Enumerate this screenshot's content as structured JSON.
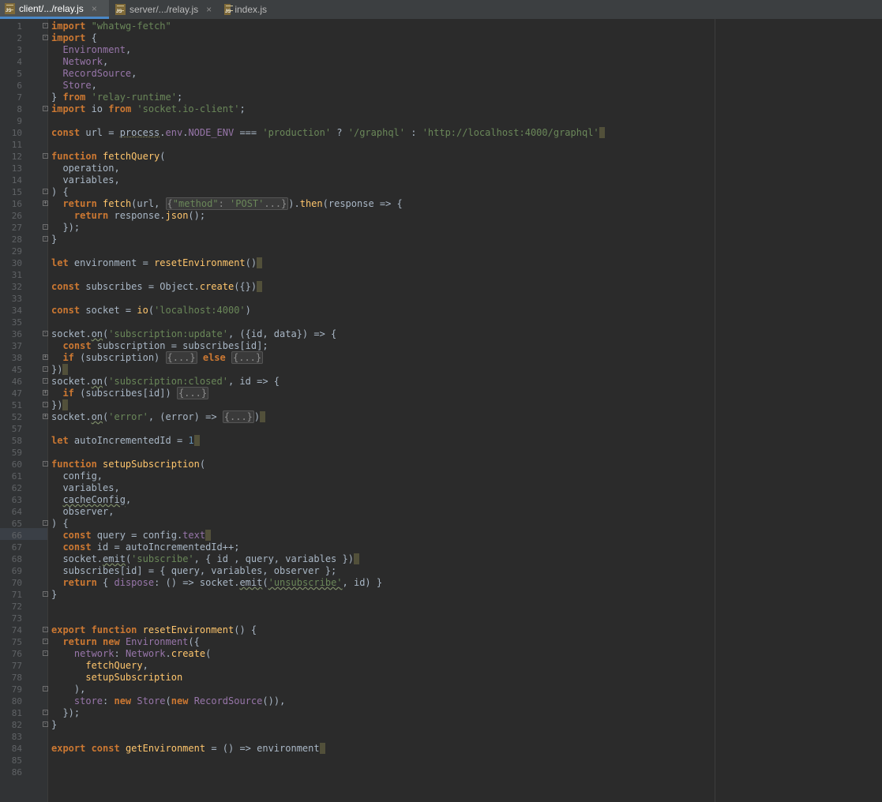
{
  "tabs": [
    {
      "label": "client/.../relay.js",
      "icon": "js-file-icon",
      "icon_text": "JS",
      "close": "×",
      "active": true
    },
    {
      "label": "server/.../relay.js",
      "icon": "js-file-icon",
      "icon_text": "JS",
      "close": "×",
      "active": false
    },
    {
      "label": "index.js",
      "icon": "js-file-icon",
      "icon_text": "JS",
      "close": "",
      "active": false
    }
  ],
  "editor": {
    "current_line": 66,
    "lines": [
      {
        "n": "1",
        "fold": "-",
        "html": "<span class='kw'>import</span> <span class='str'>\"whatwg-fetch\"</span>"
      },
      {
        "n": "2",
        "fold": "-",
        "html": "<span class='kw'>import</span> {"
      },
      {
        "n": "3",
        "html": "  <span class='pur'>Environment</span>,"
      },
      {
        "n": "4",
        "html": "  <span class='pur'>Network</span>,"
      },
      {
        "n": "5",
        "html": "  <span class='pur'>RecordSource</span>,"
      },
      {
        "n": "6",
        "html": "  <span class='pur'>Store</span>,"
      },
      {
        "n": "7",
        "html": "} <span class='kw'>from</span> <span class='str'>'relay-runtime'</span>;"
      },
      {
        "n": "8",
        "fold": "-",
        "html": "<span class='kw'>import</span> io <span class='kw'>from</span> <span class='str'>'socket.io-client'</span>;"
      },
      {
        "n": "9",
        "html": ""
      },
      {
        "n": "10",
        "html": "<span class='kw'>const</span> url = <span class='warn'>process</span>.<span class='fld'>env</span>.<span class='fld'>NODE_ENV</span> === <span class='str'>'production'</span> ? <span class='str'>'/graphql'</span> : <span class='str'>'http://localhost:4000/graphql'</span><span class='caret'></span>"
      },
      {
        "n": "11",
        "html": ""
      },
      {
        "n": "12",
        "fold": "-",
        "html": "<span class='kw'>function</span> <span class='fn'>fetchQuery</span>("
      },
      {
        "n": "13",
        "html": "  operation,"
      },
      {
        "n": "14",
        "html": "  variables,"
      },
      {
        "n": "15",
        "fold": "-",
        "html": ") {"
      },
      {
        "n": "16",
        "fold": "+",
        "html": "  <span class='kw'>return</span> <span class='fn'>fetch</span>(url, <span class='fg'>{<span class='str'>\"method\"</span>: <span class='str'>'POST'</span>...}</span>).<span class='fn'>then</span>(response => {"
      },
      {
        "n": "26",
        "html": "    <span class='kw'>return</span> response.<span class='fn'>json</span>();"
      },
      {
        "n": "27",
        "fold": "-",
        "html": "  });"
      },
      {
        "n": "28",
        "fold": "-",
        "html": "}"
      },
      {
        "n": "29",
        "html": ""
      },
      {
        "n": "30",
        "html": "<span class='kw'>let</span> environment = <span class='fn'>resetEnvironment</span>()<span class='caret'></span>"
      },
      {
        "n": "31",
        "html": ""
      },
      {
        "n": "32",
        "html": "<span class='kw'>const</span> subscribes = Object.<span class='fn'>create</span>({})<span class='caret'></span>"
      },
      {
        "n": "33",
        "html": ""
      },
      {
        "n": "34",
        "html": "<span class='kw'>const</span> socket = <span class='fn'>io</span>(<span class='str'>'localhost:4000'</span>)"
      },
      {
        "n": "35",
        "html": ""
      },
      {
        "n": "36",
        "fold": "-",
        "html": "socket.<span class='und'>on</span>(<span class='str'>'subscription:update'</span>, ({id, data}) => {"
      },
      {
        "n": "37",
        "html": "  <span class='kw'>const</span> subscription = subscribes[id];"
      },
      {
        "n": "38",
        "fold": "+",
        "html": "  <span class='kw'>if</span> (subscription) <span class='fg'>{...}</span> <span class='kw'>else</span> <span class='fg'>{...}</span>"
      },
      {
        "n": "45",
        "fold": "-",
        "html": "})<span class='caret'></span>"
      },
      {
        "n": "46",
        "fold": "-",
        "html": "socket.<span class='und'>on</span>(<span class='str'>'subscription:closed'</span>, id => {"
      },
      {
        "n": "47",
        "fold": "+",
        "html": "  <span class='kw'>if</span> (subscribes[id]) <span class='fg'>{...}</span>"
      },
      {
        "n": "51",
        "fold": "-",
        "html": "})<span class='caret'></span>"
      },
      {
        "n": "52",
        "fold": "+",
        "html": "socket.<span class='und'>on</span>(<span class='str'>'error'</span>, (error) => <span class='fg'>{...}</span>)<span class='caret'></span>"
      },
      {
        "n": "57",
        "html": ""
      },
      {
        "n": "58",
        "html": "<span class='kw'>let</span> autoIncrementedId = <span class='num'>1</span><span class='caret'></span>"
      },
      {
        "n": "59",
        "html": ""
      },
      {
        "n": "60",
        "fold": "-",
        "html": "<span class='kw'>function</span> <span class='fn'>setupSubscription</span>("
      },
      {
        "n": "61",
        "html": "  config,"
      },
      {
        "n": "62",
        "html": "  variables,"
      },
      {
        "n": "63",
        "html": "  <span class='und'>cacheConfig</span>,"
      },
      {
        "n": "64",
        "html": "  observer,"
      },
      {
        "n": "65",
        "fold": "-",
        "html": ") {"
      },
      {
        "n": "66",
        "html": "  <span class='kw'>const</span> query = config.<span class='fld'>text</span><span class='caret'></span>"
      },
      {
        "n": "67",
        "html": "  <span class='kw'>const</span> id = autoIncrementedId++;"
      },
      {
        "n": "68",
        "html": "  socket.<span class='und'>emit</span>(<span class='str'>'subscribe'</span>, { id , query, variables })<span class='caret'></span>"
      },
      {
        "n": "69",
        "html": "  subscribes[id] = { query, variables, observer };"
      },
      {
        "n": "70",
        "html": "  <span class='kw'>return</span> { <span class='fld'>dispose</span>: () => socket.<span class='und'>emit</span>(<span class='str und'>'unsubscribe'</span>, id) }"
      },
      {
        "n": "71",
        "fold": "-",
        "html": "}"
      },
      {
        "n": "72",
        "html": ""
      },
      {
        "n": "73",
        "html": ""
      },
      {
        "n": "74",
        "fold": "-",
        "html": "<span class='kw'>export</span> <span class='kw'>function</span> <span class='fn'>resetEnvironment</span>() {"
      },
      {
        "n": "75",
        "fold": "-",
        "html": "  <span class='kw'>return new</span> <span class='pur'>Environment</span>({"
      },
      {
        "n": "76",
        "fold": "-",
        "html": "    <span class='fld'>network</span>: <span class='pur'>Network</span>.<span class='fn'>create</span>("
      },
      {
        "n": "77",
        "html": "      <span class='fn'>fetchQuery</span>,"
      },
      {
        "n": "78",
        "html": "      <span class='fn'>setupSubscription</span>"
      },
      {
        "n": "79",
        "fold": "-",
        "html": "    ),"
      },
      {
        "n": "80",
        "html": "    <span class='fld'>store</span>: <span class='kw'>new</span> <span class='pur'>Store</span>(<span class='kw'>new</span> <span class='pur'>RecordSource</span>()),"
      },
      {
        "n": "81",
        "fold": "-",
        "html": "  });"
      },
      {
        "n": "82",
        "fold": "-",
        "html": "}"
      },
      {
        "n": "83",
        "html": ""
      },
      {
        "n": "84",
        "html": "<span class='kw'>export const</span> <span class='fn'>getEnvironment</span> = () => environment<span class='caret'></span>"
      },
      {
        "n": "85",
        "html": ""
      },
      {
        "n": "86",
        "html": ""
      }
    ]
  }
}
